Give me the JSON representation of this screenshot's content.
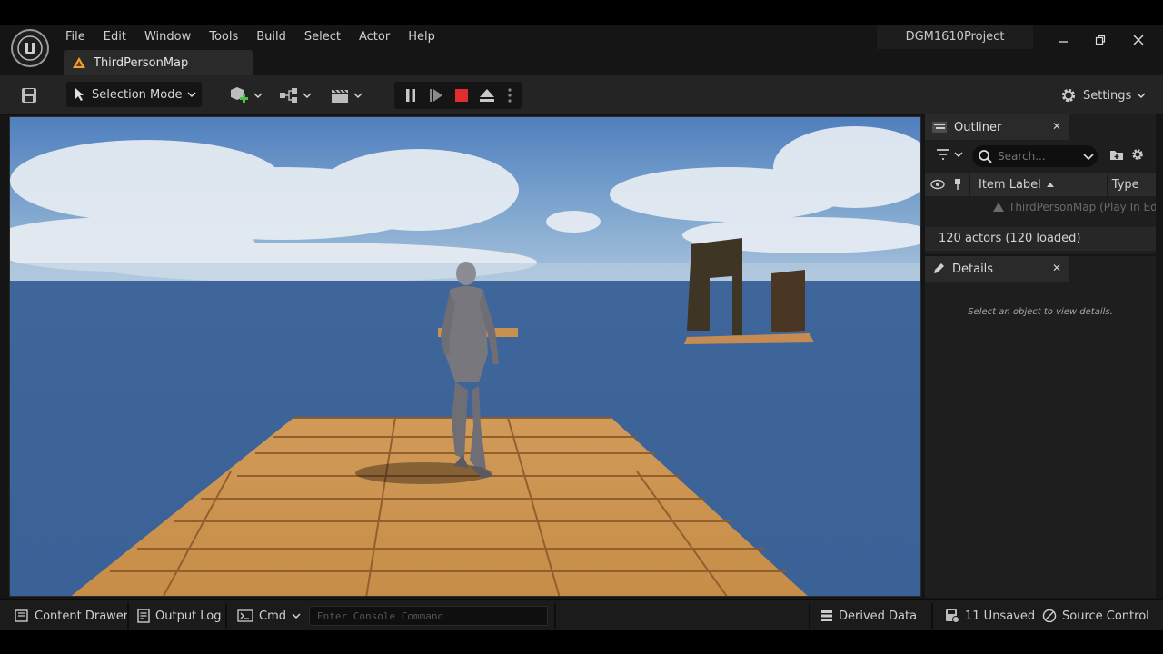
{
  "app": {
    "project_name": "DGM1610Project",
    "menu": [
      "File",
      "Edit",
      "Window",
      "Tools",
      "Build",
      "Select",
      "Actor",
      "Help"
    ],
    "level_tab": "ThirdPersonMap"
  },
  "toolbar": {
    "mode_label": "Selection Mode",
    "settings_label": "Settings"
  },
  "outliner": {
    "title": "Outliner",
    "search_placeholder": "Search...",
    "col_item_label": "Item Label",
    "col_type": "Type",
    "root_item": "ThirdPersonMap (Play In Ed",
    "actor_count": "120 actors (120 loaded)"
  },
  "details": {
    "title": "Details",
    "empty_text": "Select an object to view details."
  },
  "statusbar": {
    "content_drawer": "Content Drawer",
    "output_log": "Output Log",
    "cmd": "Cmd",
    "console_placeholder": "Enter Console Command",
    "derived_data": "Derived Data",
    "unsaved": "11 Unsaved",
    "source_control": "Source Control"
  },
  "colors": {
    "accent_orange": "#f0a030",
    "stop_red": "#e02d2d",
    "add_green": "#4fc04a",
    "sky": "#5f8fc4",
    "ocean": "#3d6398",
    "wood": "#c28a48"
  }
}
